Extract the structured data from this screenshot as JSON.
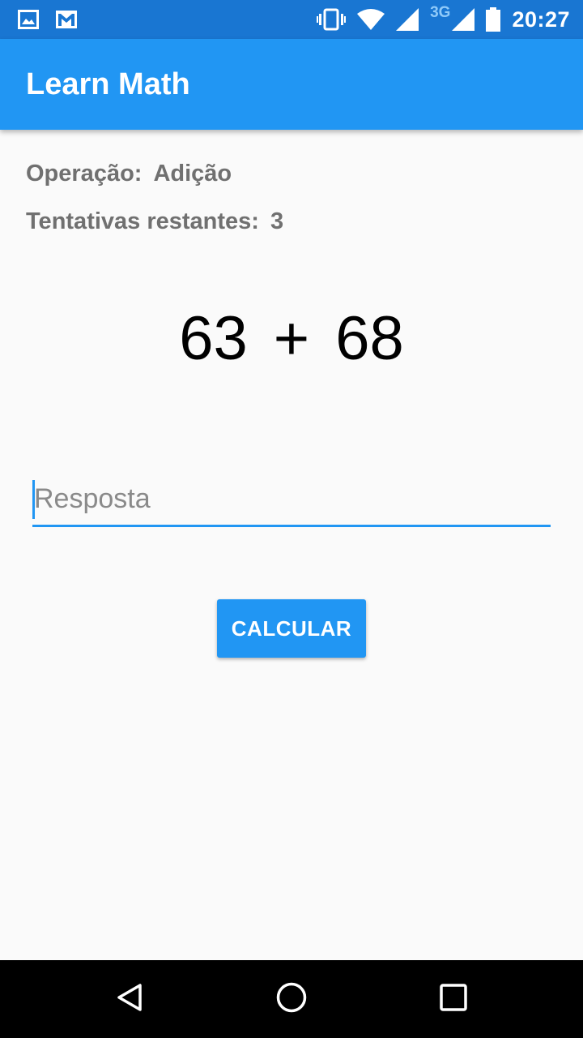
{
  "status_bar": {
    "network_label": "3G",
    "time": "20:27",
    "icons": [
      "image-notification-icon",
      "gmail-icon",
      "vibrate-icon",
      "wifi-icon",
      "signal-icon",
      "signal-3g-icon",
      "battery-icon"
    ]
  },
  "app_bar": {
    "title": "Learn Math"
  },
  "info": {
    "operation_label": "Operação:",
    "operation_value": "Adição",
    "attempts_label": "Tentativas restantes:",
    "attempts_value": "3"
  },
  "equation": {
    "left": "63",
    "operator": "+",
    "right": "68"
  },
  "answer": {
    "value": "",
    "placeholder": "Resposta"
  },
  "calculate_button": {
    "label": "CALCULAR"
  },
  "colors": {
    "primary": "#2196f3",
    "primary_dark": "#1976d2",
    "background": "#fafafa",
    "nav_bar": "#000000"
  },
  "nav_bar": {
    "icons": [
      "back-icon",
      "home-icon",
      "recents-icon"
    ]
  }
}
